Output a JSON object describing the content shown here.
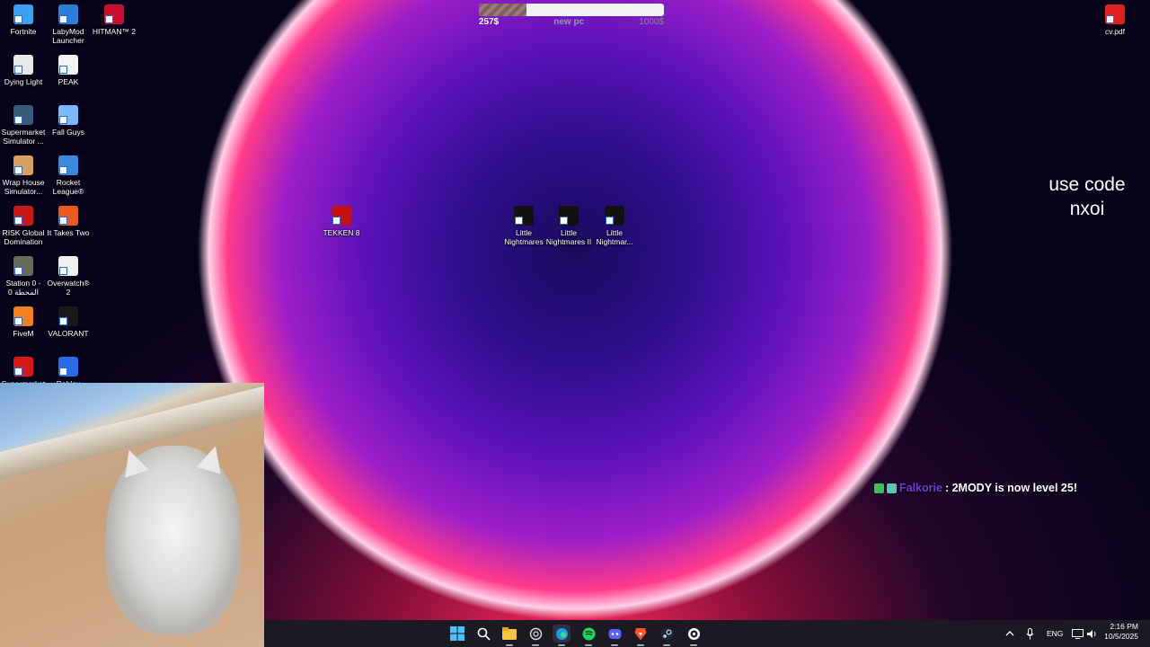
{
  "desktop_icons": [
    {
      "label": "Fortnite",
      "icon": "fortnite-icon",
      "color": "#3aa0f0"
    },
    {
      "label": "LabyMod Launcher",
      "icon": "labymod-icon",
      "color": "#2b7fd6"
    },
    {
      "label": "HITMAN™ 2",
      "icon": "hitman-icon",
      "color": "#c8102e"
    },
    {
      "label": "Dying Light",
      "icon": "dying-light-icon",
      "color": "#e8e8e8"
    },
    {
      "label": "PEAK",
      "icon": "peak-icon",
      "color": "#f4f4f4"
    },
    {
      "label": "Supermarket Simulator ...",
      "icon": "supermarket-simulator-icon",
      "color": "#3a5a7a"
    },
    {
      "label": "Fall Guys",
      "icon": "fall-guys-icon",
      "color": "#7ab8ff"
    },
    {
      "label": "Wrap House Simulator...",
      "icon": "wrap-house-icon",
      "color": "#d8a060"
    },
    {
      "label": "Rocket League®",
      "icon": "rocket-league-icon",
      "color": "#3a8ae0"
    },
    {
      "label": "RISK Global Domination",
      "icon": "risk-icon",
      "color": "#c81818"
    },
    {
      "label": "It Takes Two",
      "icon": "it-takes-two-icon",
      "color": "#e85a20"
    },
    {
      "label": "Station 0 - المحطة 0",
      "icon": "station-0-icon",
      "color": "#6a6a5a"
    },
    {
      "label": "Overwatch® 2",
      "icon": "overwatch-icon",
      "color": "#f0f0f0"
    },
    {
      "label": "FiveM",
      "icon": "fivem-icon",
      "color": "#f08020"
    },
    {
      "label": "VALORANT",
      "icon": "valorant-icon",
      "color": "#1a1a1a"
    },
    {
      "label": "Supermarket",
      "icon": "supermarket-icon",
      "color": "#d81818"
    },
    {
      "label": "Roblox Player",
      "icon": "roblox-icon",
      "color": "#2a6ae8"
    },
    {
      "label": "TEKKEN 8",
      "icon": "tekken-icon",
      "color": "#c01010"
    },
    {
      "label": "Little Nightmares",
      "icon": "little-nightmares-icon",
      "color": "#111111"
    },
    {
      "label": "Little Nightmares II",
      "icon": "little-nightmares-2-icon",
      "color": "#111111"
    },
    {
      "label": "Little Nightmar...",
      "icon": "little-nightmares-3-icon",
      "color": "#111111"
    },
    {
      "label": "cv.pdf",
      "icon": "pdf-icon",
      "color": "#e02020"
    }
  ],
  "goal": {
    "current": "257$",
    "name": "new pc",
    "target": "1000$",
    "progress_fraction": 0.257
  },
  "promo": {
    "line1": "use code",
    "line2": "nxoi"
  },
  "chat": {
    "user": "Falkorie",
    "text": ": 2MODY is now level 25!"
  },
  "taskbar": {
    "apps": [
      "windows-start-icon",
      "search-icon",
      "file-explorer-icon",
      "chatgpt-icon",
      "edge-icon",
      "spotify-icon",
      "discord-icon",
      "brave-icon",
      "steam-icon",
      "obs-icon"
    ],
    "tray_language": "ENG",
    "time": "2:16 PM",
    "date": "10/5/2025"
  }
}
